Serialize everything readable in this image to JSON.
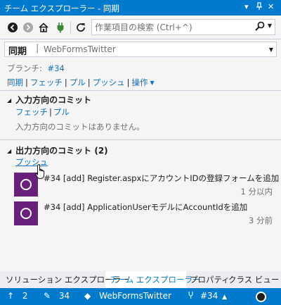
{
  "window": {
    "title": "チーム エクスプローラー - 同期"
  },
  "titlebar_controls": {
    "dropdown": "▾",
    "pin": "⊣",
    "close": "✕"
  },
  "toolbar": {
    "search_placeholder": "作業項目の検索 (Ctrl+^)",
    "back_icon": "back-arrow-icon",
    "forward_icon": "forward-arrow-icon",
    "home_icon": "home-icon",
    "connect_icon": "plug-icon",
    "refresh_icon": "refresh-icon"
  },
  "page": {
    "title": "同期",
    "separator": "|",
    "subtitle": "WebFormsTwitter"
  },
  "branch": {
    "label": "ブランチ:",
    "value": "#34"
  },
  "actions": {
    "sync": "同期",
    "fetch": "フェッチ",
    "pull": "プル",
    "push": "プッシュ",
    "operations": "操作",
    "sep": "|"
  },
  "incoming": {
    "header": "入力方向のコミット",
    "fetch": "フェッチ",
    "pull": "プル",
    "empty_message": "入力方向のコミットはありません。"
  },
  "outgoing": {
    "header": "出力方向のコミット (2)",
    "push": "プッシュ",
    "commits": [
      {
        "message": "#34 [add] Register.aspxにアカウントIDの登録フォームを追加",
        "time": "1 分以内"
      },
      {
        "message": "#34 [add] ApplicationUserモデルにAccountIdを追加",
        "time": "3 分前"
      }
    ]
  },
  "tabs": {
    "solution_explorer": "ソリューション エクスプローラー",
    "team_explorer": "チーム エクスプローラー",
    "properties": "プロパティ",
    "class_view": "クラス ビュー"
  },
  "statusbar": {
    "arrow_up_count": "2",
    "edit_count": "34",
    "repo": "WebFormsTwitter",
    "branch": "#34"
  },
  "colors": {
    "accent": "#007acc",
    "link": "#0e70c0",
    "avatar": "#68217a",
    "panel_bg": "#f5f5f5"
  }
}
